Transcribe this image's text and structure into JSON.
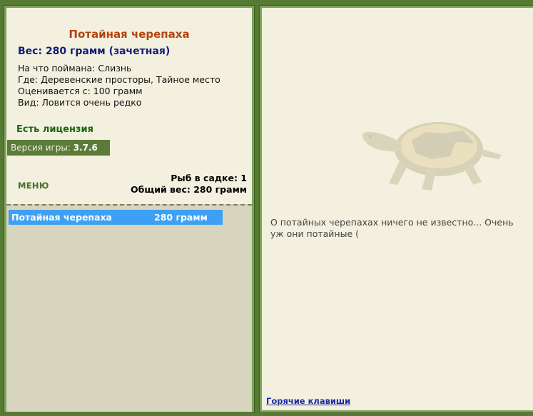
{
  "fish": {
    "name": "Потайная черепаха",
    "weight_line": "Вес: 280 грамм (зачетная)",
    "caught_on": "На что поймана: Слизнь",
    "location": "Где: Деревенские просторы, Тайное место",
    "valued_from": "Оценивается с: 100 грамм",
    "rarity": "Вид: Ловится очень редко"
  },
  "license": "Есть лицензия",
  "version": {
    "label": "Версия игры:",
    "value": "3.7.6"
  },
  "menu_label": "МЕНЮ",
  "stats": {
    "fish_count": "Рыб в садке: 1",
    "total_weight": "Общий вес: 280 грамм"
  },
  "catch_list": [
    {
      "name": "Потайная черепаха",
      "weight": "280 грамм"
    }
  ],
  "description": "О потайных черепахах ничего не известно... Очень уж они потайные (",
  "hotkeys_link": "Горячие клавиши"
}
